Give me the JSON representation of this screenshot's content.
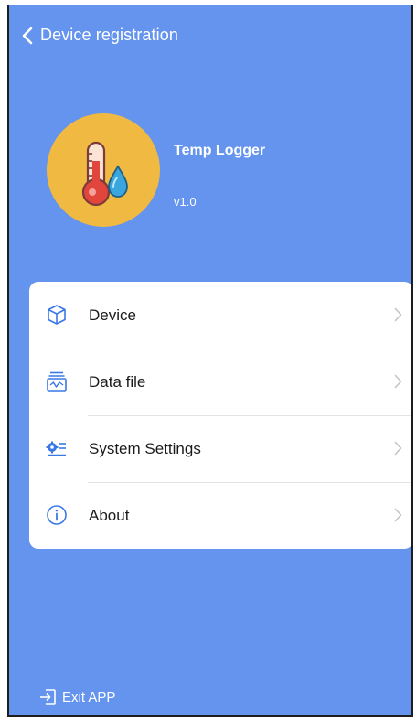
{
  "header": {
    "title": "Device registration",
    "back_icon": "chevron-left-icon"
  },
  "app": {
    "name": "Temp Logger",
    "version": "v1.0",
    "logo_icon": "thermometer-droplet-icon"
  },
  "menu": {
    "items": [
      {
        "label": "Device",
        "icon": "cube-icon"
      },
      {
        "label": "Data file",
        "icon": "data-file-icon"
      },
      {
        "label": "System Settings",
        "icon": "settings-list-icon"
      },
      {
        "label": "About",
        "icon": "info-icon"
      }
    ]
  },
  "footer": {
    "exit_label": "Exit APP",
    "exit_icon": "exit-icon"
  },
  "colors": {
    "background": "#6494ee",
    "logo_circle": "#f0b941",
    "card": "#ffffff",
    "icon_blue": "#3a78e6"
  }
}
